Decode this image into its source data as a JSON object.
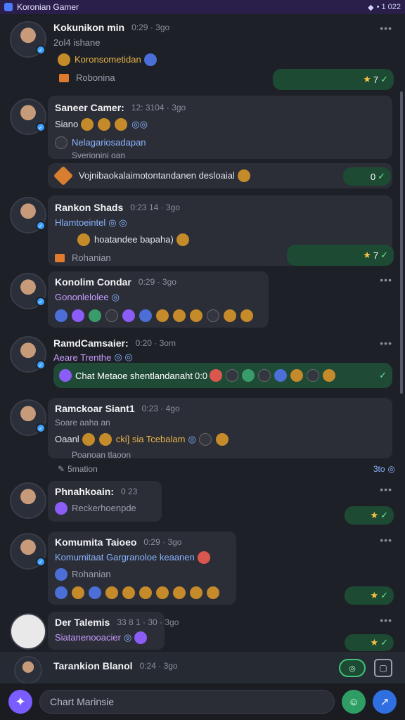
{
  "app": {
    "title": "Koronian Gamer",
    "top_right": "• 1 022"
  },
  "messages": [
    {
      "name": "Kokunikon min",
      "time": "0:29 · 3go",
      "l1": "2ol4 ishane",
      "l2": "Koronsometidan",
      "l3": "Robonina",
      "green": "7"
    },
    {
      "name": "Saneer Camer:",
      "time": "12: 3104 · 3go",
      "l1": "Siano",
      "l2": "Nelagariosadapan",
      "l2b": "Sverionini oan",
      "l3": "Vojnibaokalaimotontandanen desloaial",
      "green": "0"
    },
    {
      "name": "Rankon Shads",
      "time": "0:23 14 · 3go",
      "l1": "Hlamtoeintel",
      "l2": "hoatandee bapaha)",
      "l3": "Rohanian",
      "green": "7"
    },
    {
      "name": "Konolim Condar",
      "time": "0:29 · 3go",
      "l1": "Gononlelolee"
    },
    {
      "name": "RamdCamsaier:",
      "time": "0:20 · 3om",
      "l1": "Aeare Trenthe",
      "l2": "Chat Metaoe shentlandanaht",
      "l2b": "0:0"
    },
    {
      "name": "Ramckoar Siant1",
      "time": "0:23 · 4go",
      "l1": "Soare aaha an",
      "l2": "Oaanl",
      "l2b": "cki] sia Tcebalam",
      "l3": "Poanoan tlaoon"
    },
    {
      "sys": "5mation",
      "sys_right": "3to"
    },
    {
      "name": "Phnahkoain:",
      "time": "0 23",
      "l1": "Reckerhoenpde"
    },
    {
      "name": "Komumita Taioeo",
      "time": "0:29 · 3go",
      "l1": "Komumitaat Gargranoloe keaanen",
      "l2": "Rohanian"
    },
    {
      "name": "Der Talemis",
      "time": "33 8 1 · 30 · 3go",
      "l1": "Siatanenooacier"
    },
    {
      "name": "Tarankion Blanol",
      "time": "0:24 · 3go"
    }
  ],
  "composer": {
    "placeholder": "Chart Marinsie"
  }
}
